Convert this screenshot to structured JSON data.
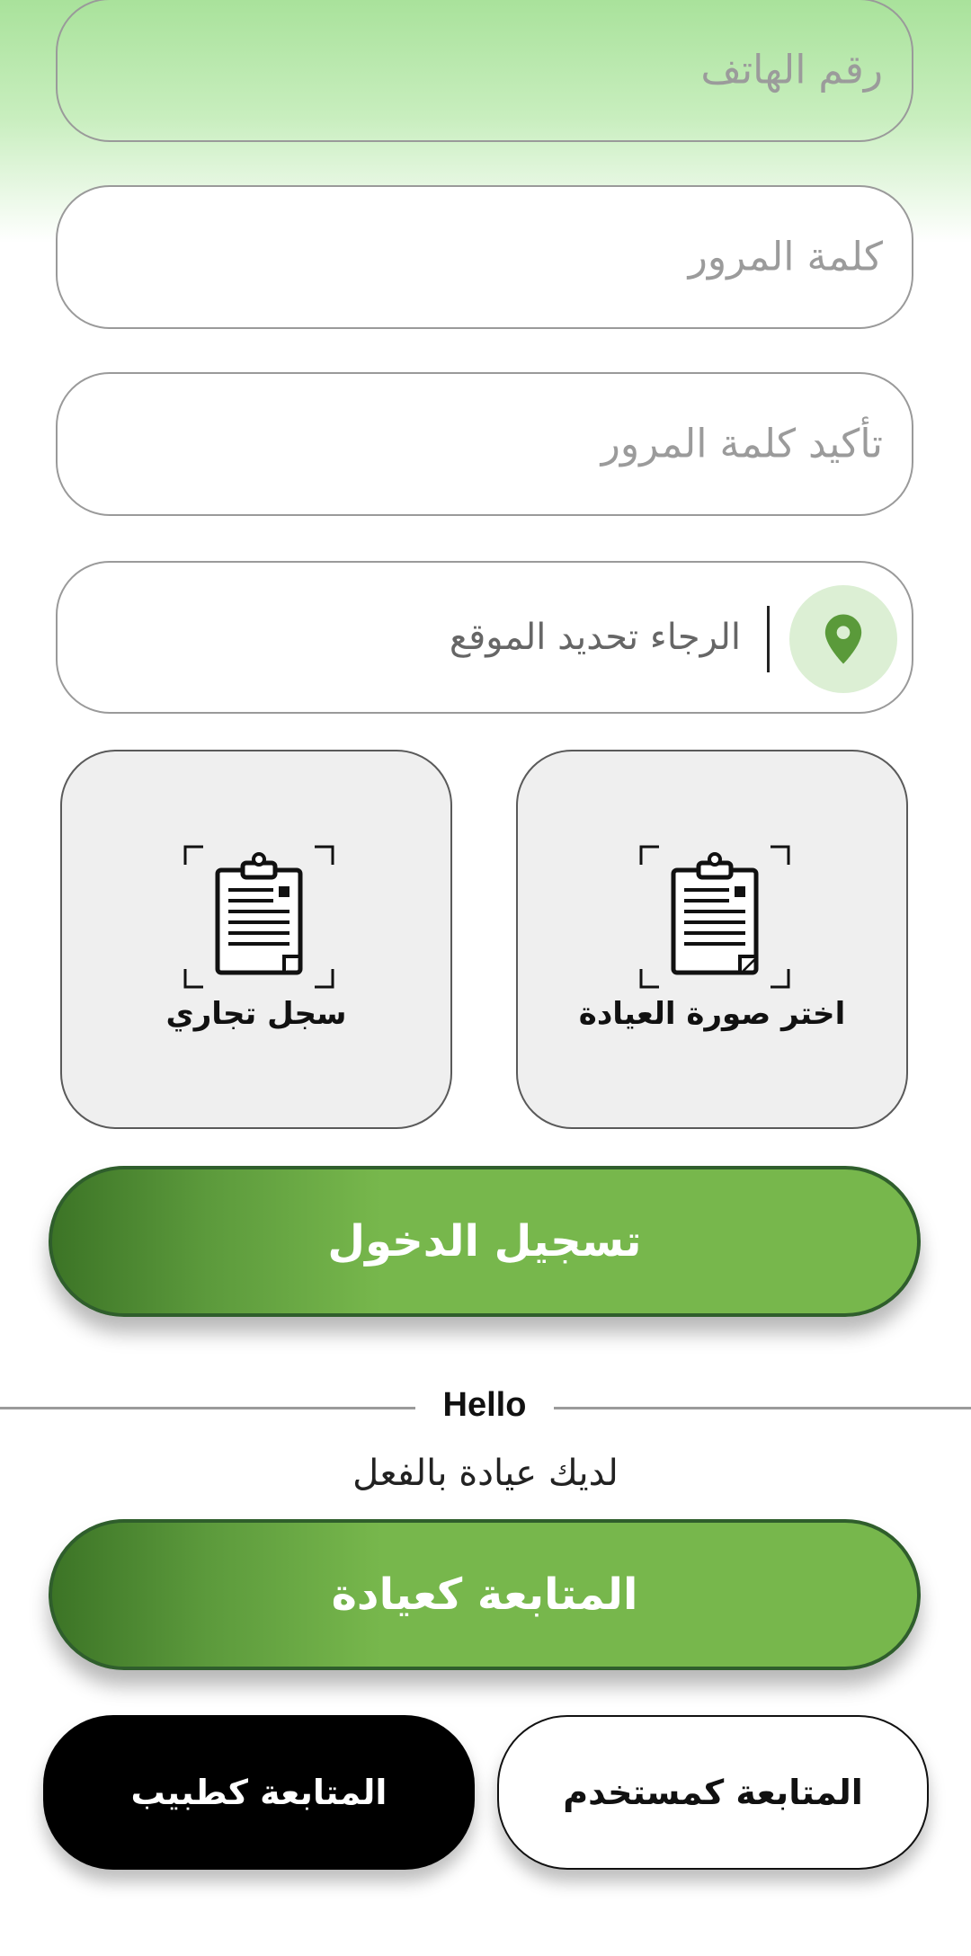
{
  "form": {
    "phone_placeholder": "رقم الهاتف",
    "password_placeholder": "كلمة المرور",
    "confirm_password_placeholder": "تأكيد كلمة المرور",
    "location_placeholder": "الرجاء تحديد الموقع",
    "location_icon": "map-pin-icon"
  },
  "uploads": {
    "clinic_photo_label": "اختر صورة العيادة",
    "commercial_register_label": "سجل تجاري",
    "icon": "clipboard-scan-icon"
  },
  "buttons": {
    "login_label": "تسجيل الدخول",
    "continue_clinic_label": "المتابعة كعيادة",
    "continue_doctor_label": "المتابعة كطبيب",
    "continue_user_label": "المتابعة كمستخدم"
  },
  "divider": {
    "text": "Hello"
  },
  "already_have_clinic": "لديك عيادة بالفعل",
  "colors": {
    "accent_green": "#77b74c",
    "dark_green": "#2f5e2c",
    "pin_green": "#5a9a3a"
  }
}
